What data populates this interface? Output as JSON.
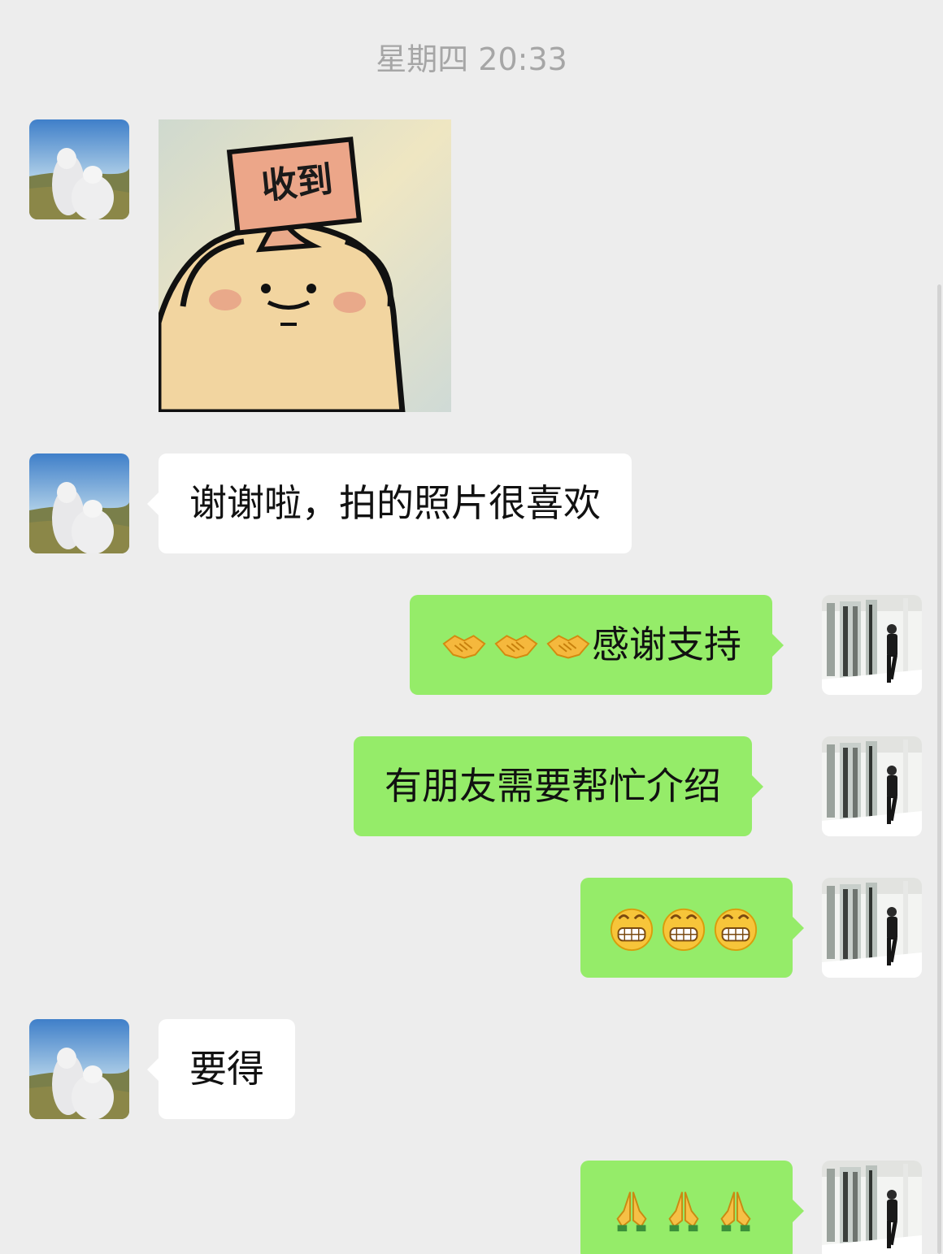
{
  "timestamp": "星期四 20:33",
  "sticker": {
    "label": "收到"
  },
  "messages": [
    {
      "side": "in",
      "type": "sticker"
    },
    {
      "side": "in",
      "type": "text",
      "text": "谢谢啦，拍的照片很喜欢"
    },
    {
      "side": "out",
      "type": "text",
      "emoji": "handshake-icon",
      "emoji_count": 3,
      "text": "感谢支持"
    },
    {
      "side": "out",
      "type": "text",
      "text": "有朋友需要帮忙介绍"
    },
    {
      "side": "out",
      "type": "emoji",
      "emoji": "grin-icon",
      "emoji_count": 3
    },
    {
      "side": "in",
      "type": "text",
      "text": "要得"
    },
    {
      "side": "out",
      "type": "emoji",
      "emoji": "pray-icon",
      "emoji_count": 3
    }
  ],
  "colors": {
    "background": "#ededed",
    "incoming_bubble": "#ffffff",
    "outgoing_bubble": "#95ec69",
    "timestamp": "#a6a6a6"
  }
}
